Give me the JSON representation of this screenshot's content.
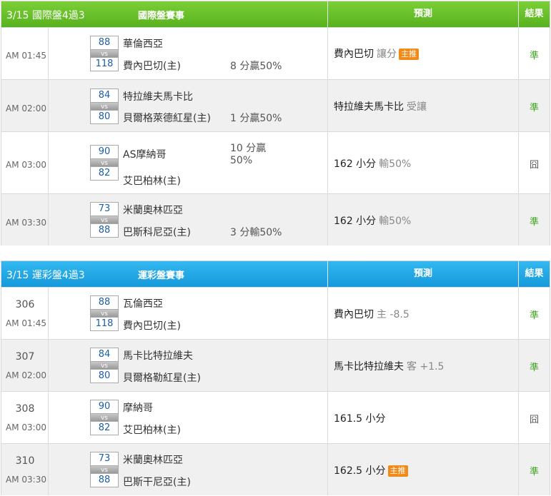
{
  "intl": {
    "header": {
      "date": "3/15 國際盤4過3",
      "name": "國際盤賽事",
      "pred": "預測",
      "res": "結果"
    },
    "rows": [
      {
        "time": "AM 01:45",
        "s1": "88",
        "s2": "118",
        "vs": "vs",
        "t1": "華倫西亞",
        "t2": "費內巴切(主)",
        "spread1": "",
        "spread2": "8 分贏50%",
        "pred": "費內巴切",
        "note": "讓分",
        "tag": "主推",
        "result": "準"
      },
      {
        "time": "AM 02:00",
        "s1": "84",
        "s2": "80",
        "vs": "vs",
        "t1": "特拉維夫馬卡比",
        "t2": "貝爾格萊德紅星(主)",
        "spread1": "",
        "spread2": "1 分贏50%",
        "pred": "特拉維夫馬卡比",
        "note": "受讓",
        "tag": "",
        "result": "準"
      },
      {
        "time": "AM 03:00",
        "s1": "90",
        "s2": "82",
        "vs": "vs",
        "t1": "AS摩納哥",
        "t2": "艾巴柏林(主)",
        "spread1": "10 分贏",
        "spread2": "50%",
        "pred": "162 小分",
        "note": "輸50%",
        "tag": "",
        "result": "囧"
      },
      {
        "time": "AM 03:30",
        "s1": "73",
        "s2": "88",
        "vs": "vs",
        "t1": "米蘭奧林匹亞",
        "t2": "巴斯科尼亞(主)",
        "spread1": "",
        "spread2": "3 分輸50%",
        "pred": "162 小分",
        "note": "輸50%",
        "tag": "",
        "result": "準"
      }
    ]
  },
  "lottery": {
    "header": {
      "date": "3/15 運彩盤4過3",
      "name": "運彩盤賽事",
      "pred": "預測",
      "res": "結果"
    },
    "rows": [
      {
        "game": "306",
        "time": "AM 01:45",
        "s1": "88",
        "s2": "118",
        "vs": "vs",
        "t1": "瓦倫西亞",
        "t2": "費內巴切(主)",
        "pred": "費內巴切",
        "note": "主 -8.5",
        "tag": "",
        "result": "準"
      },
      {
        "game": "307",
        "time": "AM 02:00",
        "s1": "84",
        "s2": "80",
        "vs": "vs",
        "t1": "馬卡比特拉維夫",
        "t2": "貝爾格勒紅星(主)",
        "pred": "馬卡比特拉維夫",
        "note": "客 +1.5",
        "tag": "",
        "result": "準"
      },
      {
        "game": "308",
        "time": "AM 03:00",
        "s1": "90",
        "s2": "82",
        "vs": "vs",
        "t1": "摩納哥",
        "t2": "艾巴柏林(主)",
        "pred": "161.5 小分",
        "note": "",
        "tag": "",
        "result": "囧"
      },
      {
        "game": "310",
        "time": "AM 03:30",
        "s1": "73",
        "s2": "88",
        "vs": "vs",
        "t1": "米蘭奧林匹亞",
        "t2": "巴斯干尼亞(主)",
        "pred": "162.5 小分",
        "note": "",
        "tag": "主推",
        "result": "準"
      }
    ]
  },
  "colors": {
    "intl_header": "#58b21e",
    "lottery_header": "#1699db",
    "hit": "#3ea31f",
    "tag": "#f28a17",
    "score": "#1b5ea8"
  }
}
